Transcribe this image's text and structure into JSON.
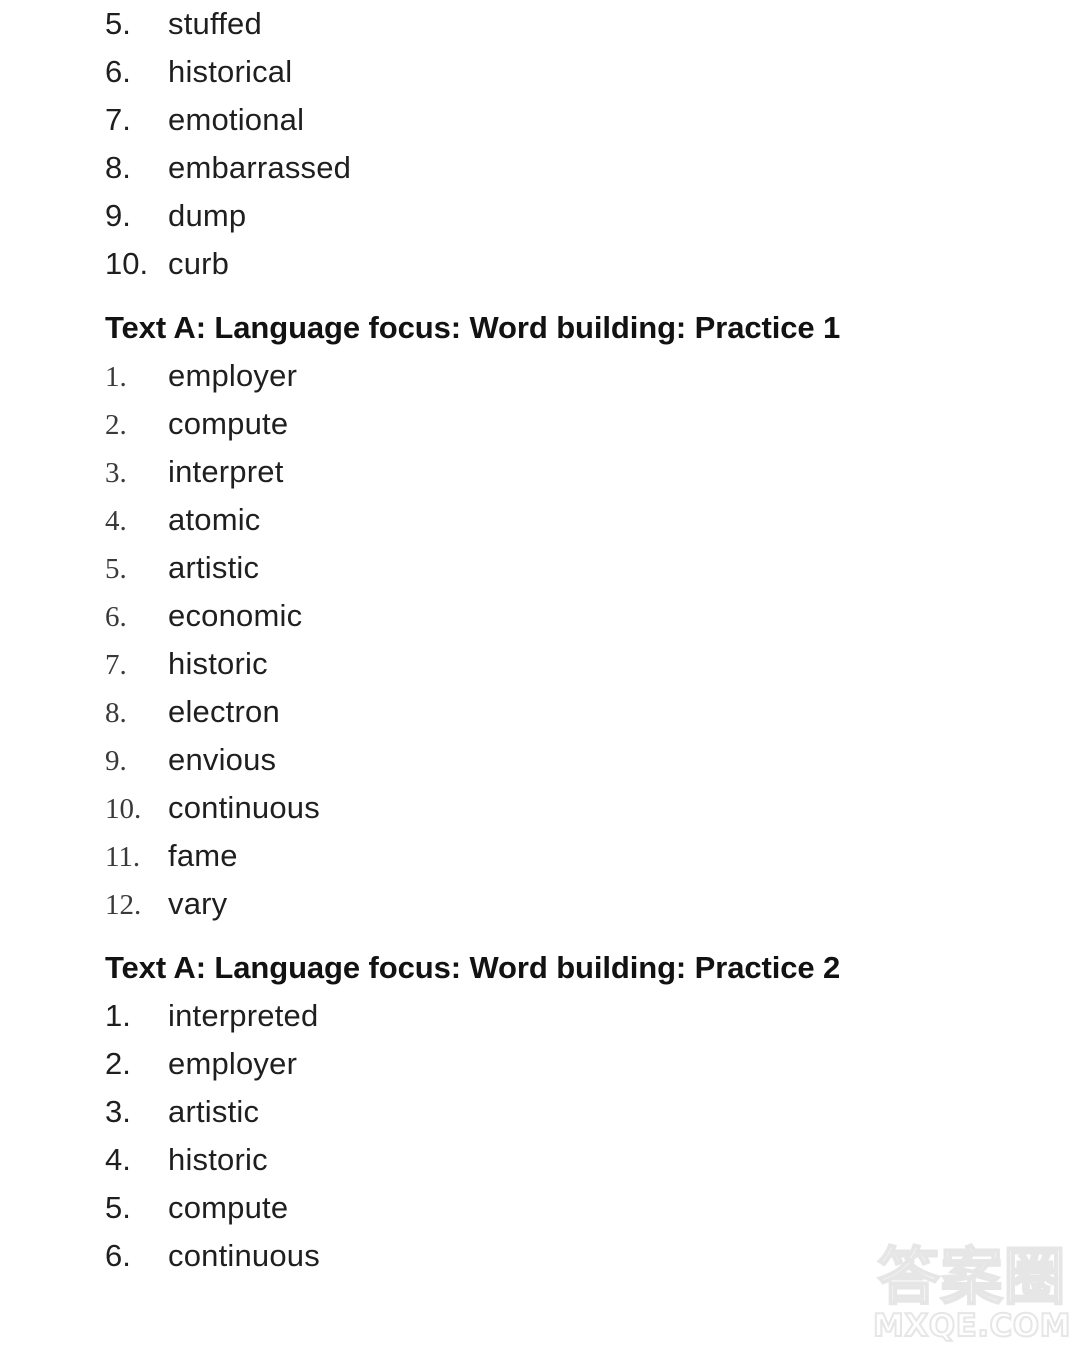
{
  "document": {
    "background_color": "#ffffff",
    "text_color": "#1f1f1f"
  },
  "blocks": [
    {
      "type": "list",
      "number_style": "sans",
      "items": [
        {
          "number": "5.",
          "word": "stuffed"
        },
        {
          "number": "6.",
          "word": "historical"
        },
        {
          "number": "7.",
          "word": "emotional"
        },
        {
          "number": "8.",
          "word": "embarrassed"
        },
        {
          "number": "9.",
          "word": "dump"
        },
        {
          "number": "10.",
          "word": "curb"
        }
      ]
    },
    {
      "type": "heading",
      "text": "Text A: Language focus: Word building: Practice 1"
    },
    {
      "type": "list",
      "number_style": "serif",
      "items": [
        {
          "number": "1.",
          "word": "employer"
        },
        {
          "number": "2.",
          "word": "compute"
        },
        {
          "number": "3.",
          "word": "interpret"
        },
        {
          "number": "4.",
          "word": "atomic"
        },
        {
          "number": "5.",
          "word": "artistic"
        },
        {
          "number": "6.",
          "word": "economic"
        },
        {
          "number": "7.",
          "word": "historic"
        },
        {
          "number": "8.",
          "word": "electron"
        },
        {
          "number": "9.",
          "word": "envious"
        },
        {
          "number": "10.",
          "word": "continuous"
        },
        {
          "number": "11.",
          "word": "fame"
        },
        {
          "number": "12.",
          "word": "vary"
        }
      ]
    },
    {
      "type": "heading",
      "text": "Text A: Language focus: Word building: Practice 2"
    },
    {
      "type": "list",
      "number_style": "sans",
      "items": [
        {
          "number": "1.",
          "word": "interpreted"
        },
        {
          "number": "2.",
          "word": "employer"
        },
        {
          "number": "3.",
          "word": "artistic"
        },
        {
          "number": "4.",
          "word": "historic"
        },
        {
          "number": "5.",
          "word": "compute"
        },
        {
          "number": "6.",
          "word": "continuous"
        }
      ]
    }
  ],
  "watermark": {
    "cjk_text": "答案圈",
    "domain_text": "MXQE.COM",
    "color": "#e6e6e6"
  }
}
